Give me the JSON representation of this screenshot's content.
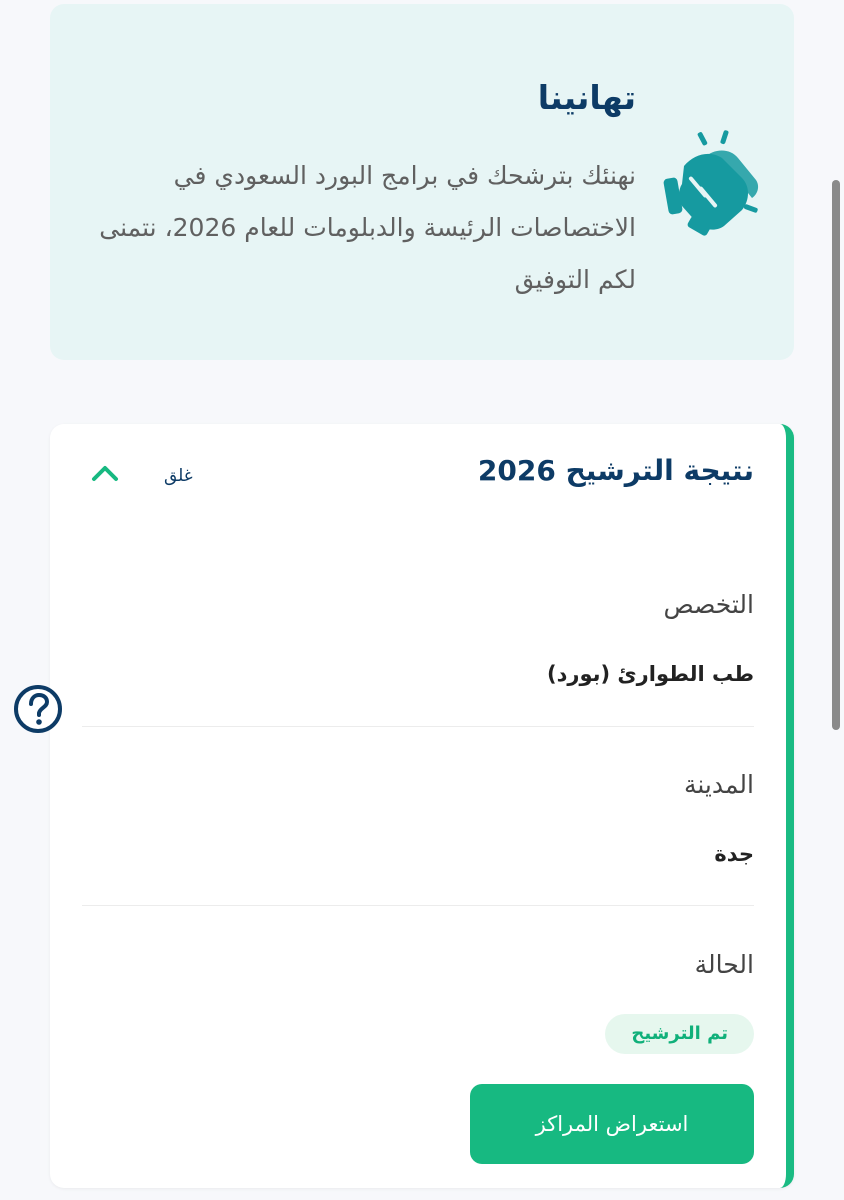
{
  "congrats": {
    "title": "تهانينا",
    "message": "نهنئك بترشحك في برامج البورد السعودي في الاختصاصات الرئيسة والدبلومات للعام 2026، نتمنى لكم التوفيق",
    "icon": "clapping-hands-icon",
    "icon_color": "#169aa0"
  },
  "result_card": {
    "title": "نتيجة الترشيح 2026",
    "close_label": "غلق",
    "accent_color": "#1abb83",
    "fields": [
      {
        "label": "التخصص",
        "value": "طب الطوارئ (بورد)"
      },
      {
        "label": "المدينة",
        "value": "جدة"
      },
      {
        "label": "الحالة",
        "value": "تم الترشيح"
      }
    ],
    "action_button": "استعراض المراكز"
  },
  "colors": {
    "title": "#0d3b66",
    "primary_green": "#17b981",
    "badge_bg": "#e6f7ee"
  }
}
